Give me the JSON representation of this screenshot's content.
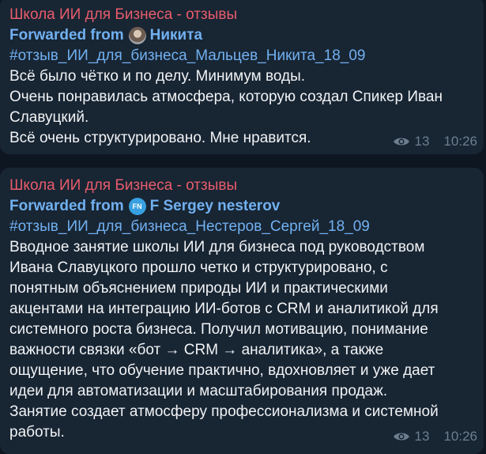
{
  "messages": [
    {
      "channel": "Школа ИИ для Бизнеса - отзывы",
      "forwarded_prefix": "Forwarded from",
      "author": "Никита",
      "avatar_initials": "",
      "hashtag": "#отзыв_ИИ_для_бизнеса_Мальцев_Никита_18_09",
      "lines": [
        "Всё было чётко и по делу. Минимум воды.",
        "Очень понравилась атмосфера, которую создал Спикер Иван",
        "Славуцкий.",
        "Всё очень структурировано. Мне нравится."
      ],
      "views": "13",
      "time": "10:26"
    },
    {
      "channel": "Школа ИИ для Бизнеса - отзывы",
      "forwarded_prefix": "Forwarded from",
      "author": "F Sergey nesterov",
      "avatar_initials": "FN",
      "hashtag": "#отзыв_ИИ_для_бизнеса_Нестеров_Сергей_18_09",
      "lines": [
        "Вводное занятие школы ИИ для бизнеса под руководством",
        "Ивана Славуцкого прошло четко и структурировано, с",
        "понятным объяснением природы ИИ и практическими",
        "акцентами на интеграцию ИИ-ботов с CRM и аналитикой для",
        "системного роста бизнеса. Получил мотивацию, понимание",
        "важности связки «бот → CRM → аналитика», а также",
        "ощущение, что обучение практично, вдохновляет и уже дает",
        "идеи для автоматизации и масштабирования продаж.",
        "Занятие создает атмосферу профессионализма и системной",
        "работы."
      ],
      "views": "13",
      "time": "10:26"
    }
  ],
  "colors": {
    "background": "#0e1621",
    "bubble": "#182533",
    "channel_name": "#e85c6c",
    "link": "#71b0f0",
    "text": "#f1f3f5",
    "meta": "#6d7f8f"
  },
  "icons": {
    "views": "eye-icon"
  }
}
